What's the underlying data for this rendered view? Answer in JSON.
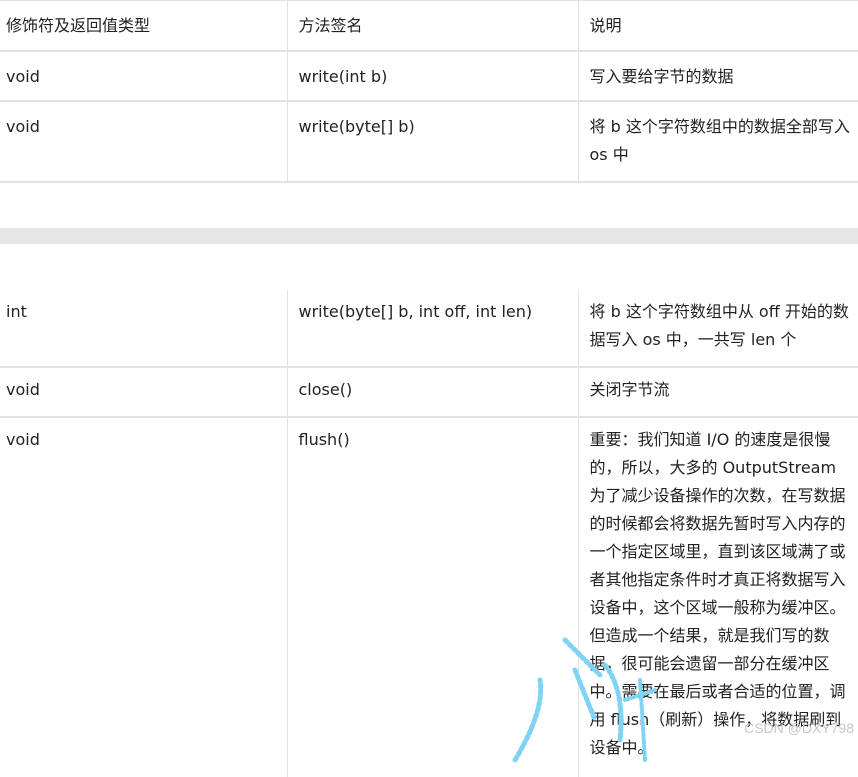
{
  "table_top": {
    "header": [
      "修饰符及返回值类型",
      "方法签名",
      "说明"
    ],
    "rows": [
      [
        "void",
        "write(int b)",
        "写入要给字节的数据"
      ],
      [
        "void",
        "write(byte[] b)",
        "将 b 这个字符数组中的数据全部写入 os 中"
      ]
    ]
  },
  "table_bottom": {
    "rows": [
      [
        "int",
        "write(byte[] b, int off, int len)",
        "将 b 这个字符数组中从 off 开始的数据写入 os 中，一共写 len 个"
      ],
      [
        "void",
        "close()",
        "关闭字节流"
      ],
      [
        "void",
        "flush()",
        "重要：我们知道 I/O 的速度是很慢的，所以，大多的 OutputStream 为了减少设备操作的次数，在写数据的时候都会将数据先暂时写入内存的一个指定区域里，直到该区域满了或者其他指定条件时才真正将数据写入设备中，这个区域一般称为缓冲区。但造成一个结果，就是我们写的数据，很可能会遗留一部分在缓冲区中。需要在最后或者合适的位置，调用 flush（刷新）操作，将数据刷到设备中。"
      ]
    ]
  },
  "watermark": {
    "text": "CSDN @DXY798"
  },
  "colors": {
    "border": "#e2e2e2",
    "gap_bar": "#e6e6e6",
    "watermark_stroke": "#7fd3f5"
  }
}
